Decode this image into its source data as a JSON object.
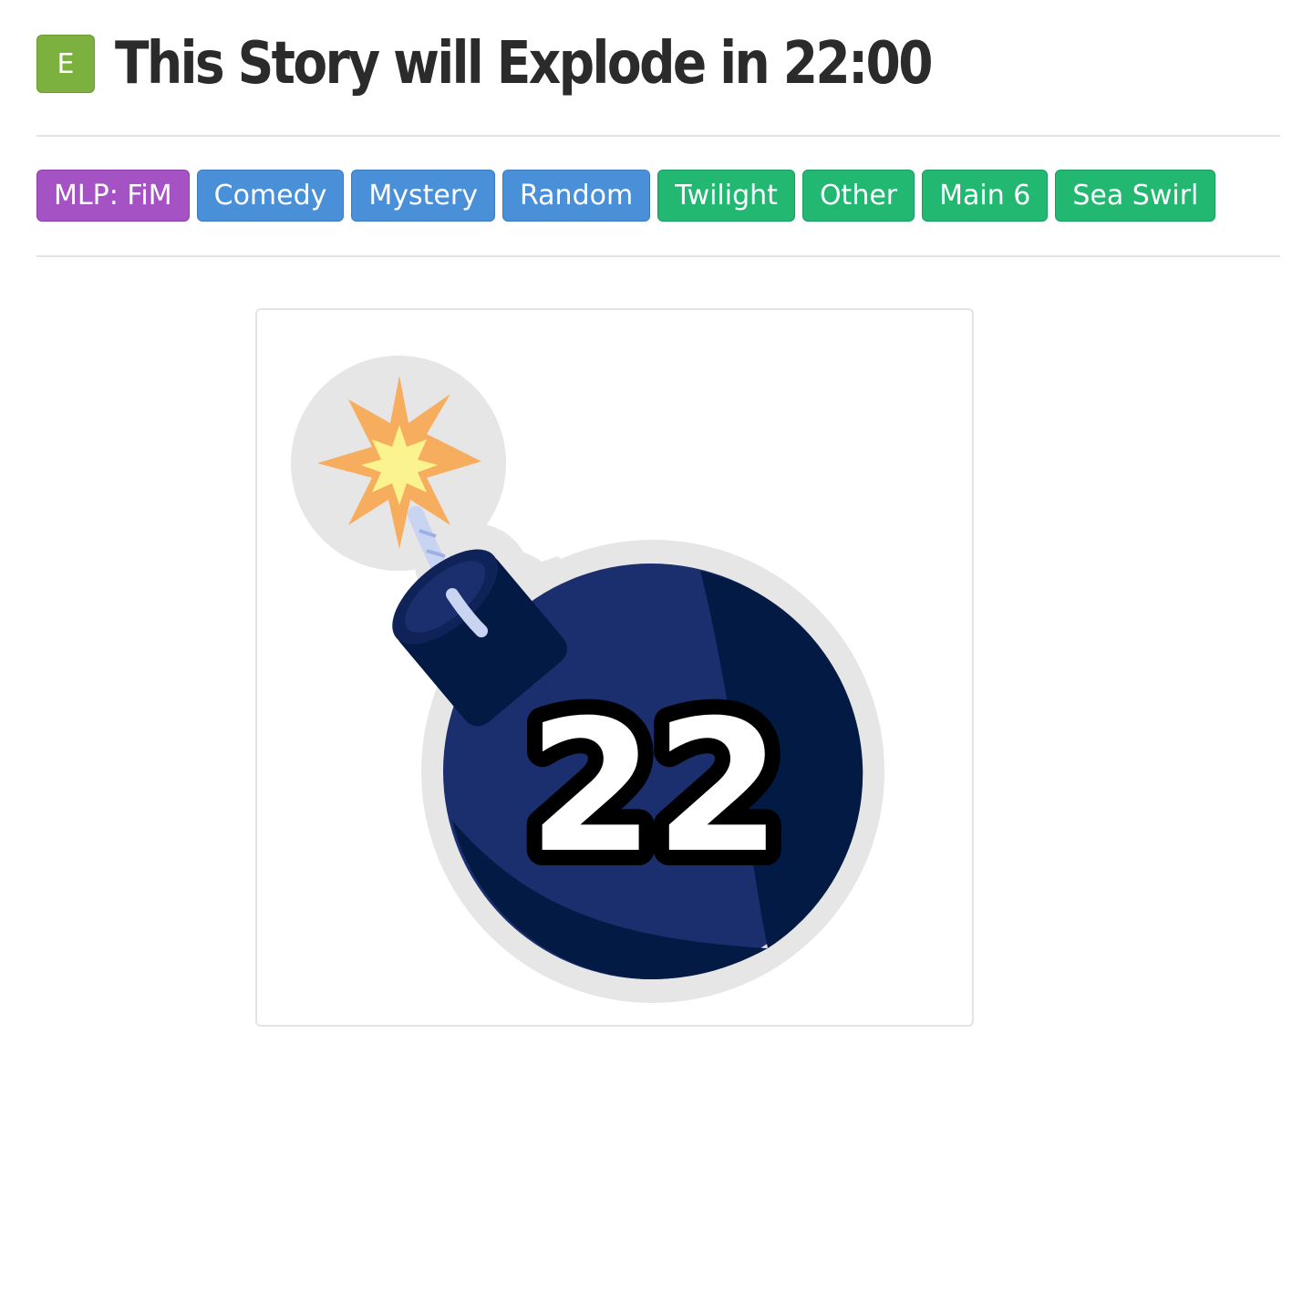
{
  "story": {
    "rating": "E",
    "title": "This Story will Explode in 22:00"
  },
  "tags": [
    {
      "label": "MLP: FiM",
      "kind": "series"
    },
    {
      "label": "Comedy",
      "kind": "genre"
    },
    {
      "label": "Mystery",
      "kind": "genre"
    },
    {
      "label": "Random",
      "kind": "genre"
    },
    {
      "label": "Twilight",
      "kind": "character"
    },
    {
      "label": "Other",
      "kind": "character"
    },
    {
      "label": "Main 6",
      "kind": "character"
    },
    {
      "label": "Sea Swirl",
      "kind": "character"
    }
  ],
  "cover": {
    "counter": "22",
    "icon": "bomb-icon"
  },
  "colors": {
    "rating_everyone": "#7cb03f",
    "tag_series": "#a552c4",
    "tag_genre": "#4a90d9",
    "tag_character": "#22b872",
    "bomb_body": "#1b2f6e",
    "bomb_dark": "#021a44",
    "spark_outer": "#f6ad5e",
    "spark_inner": "#fbf38f"
  }
}
